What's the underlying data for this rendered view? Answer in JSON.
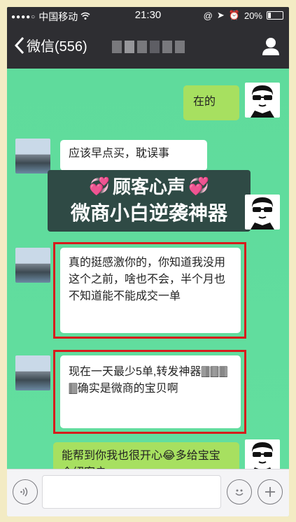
{
  "status": {
    "carrier": "中国移动",
    "time": "21:30",
    "battery": "20%",
    "battery_level": 0.2
  },
  "nav": {
    "back_label": "微信(556)"
  },
  "messages": {
    "m1": "在的",
    "m2": "应该早点买，耽误事",
    "m3": "真的挺感激你的，你知道我没用这个之前，啥也不会，半个月也不知道能不能成交一单",
    "m4": "现在一天最少5单,转发神器🀫🀫🀫🀫确实是微商的宝贝啊",
    "m5": "能帮到你我也很开心😂多给宝宝介绍客户"
  },
  "promo": {
    "line1": "顾客心声",
    "line2": "微商小白逆袭神器"
  }
}
